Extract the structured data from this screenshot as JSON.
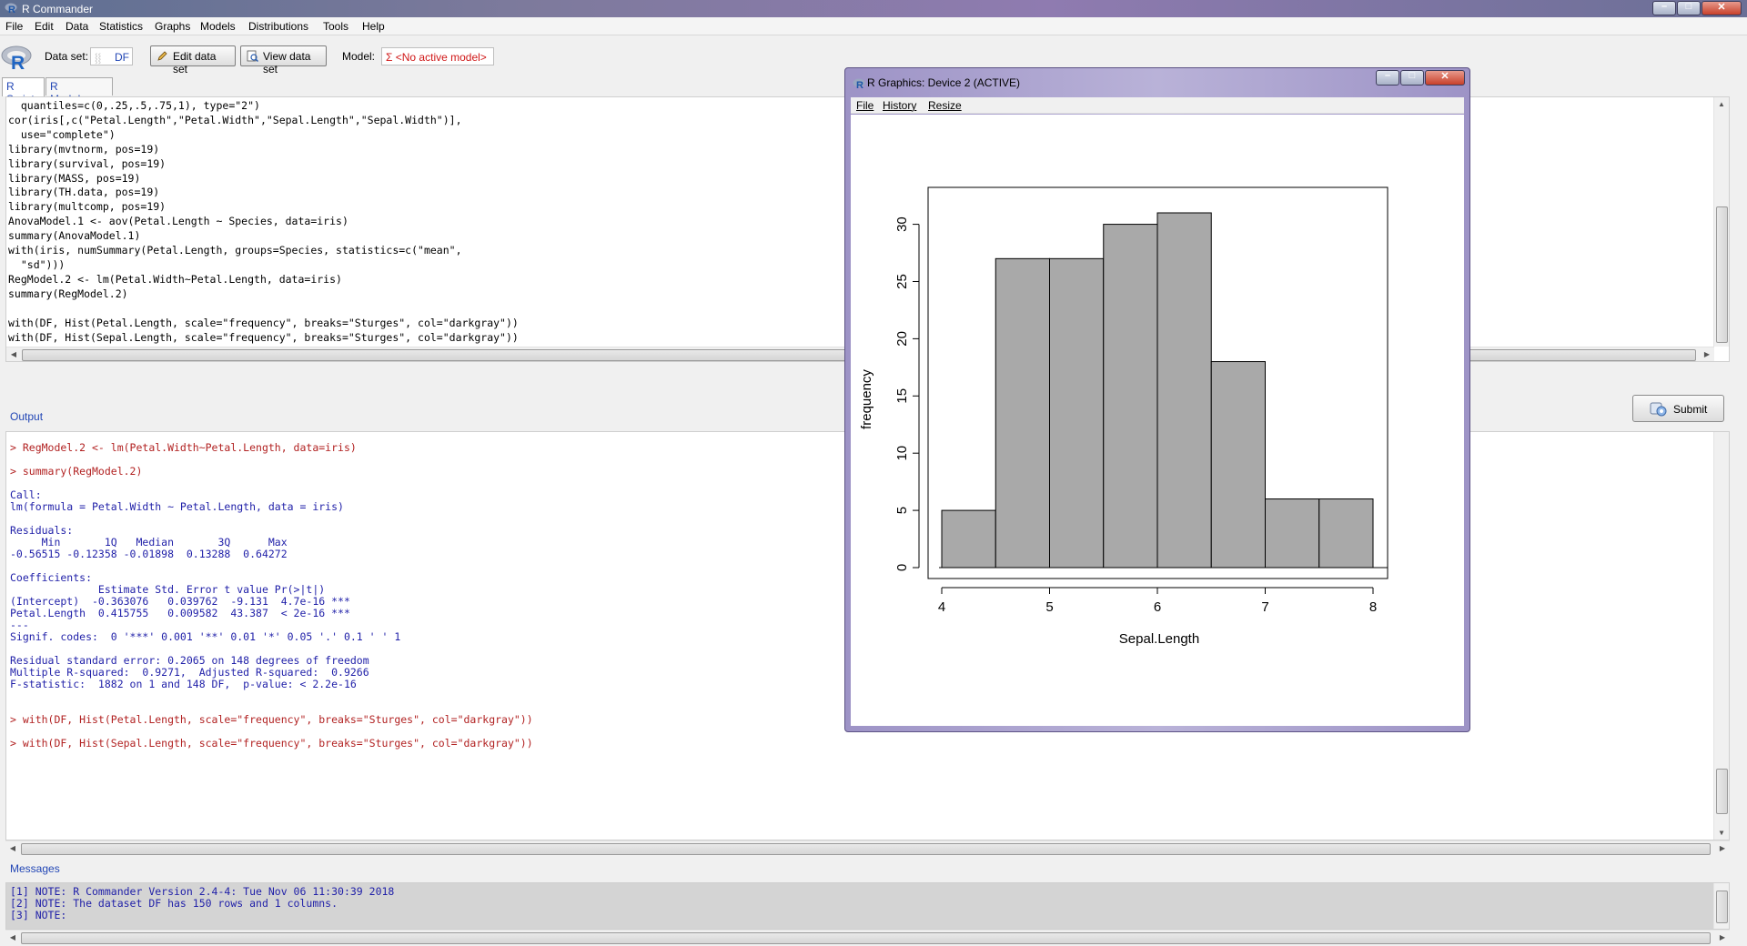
{
  "app": {
    "title": "R Commander"
  },
  "menubar": [
    "File",
    "Edit",
    "Data",
    "Statistics",
    "Graphs",
    "Models",
    "Distributions",
    "Tools",
    "Help"
  ],
  "toolbar": {
    "dataset_label": "Data set:",
    "dataset_value": "DF",
    "edit_button": "Edit data set",
    "view_button": "View data set",
    "model_label": "Model:",
    "model_value": "Σ <No active model>"
  },
  "tabs": {
    "script": "R Script",
    "markdown": "R Markdown"
  },
  "script_lines": [
    "  quantiles=c(0,.25,.5,.75,1), type=\"2\")",
    "cor(iris[,c(\"Petal.Length\",\"Petal.Width\",\"Sepal.Length\",\"Sepal.Width\")],",
    "  use=\"complete\")",
    "library(mvtnorm, pos=19)",
    "library(survival, pos=19)",
    "library(MASS, pos=19)",
    "library(TH.data, pos=19)",
    "library(multcomp, pos=19)",
    "AnovaModel.1 <- aov(Petal.Length ~ Species, data=iris)",
    "summary(AnovaModel.1)",
    "with(iris, numSummary(Petal.Length, groups=Species, statistics=c(\"mean\",",
    "  \"sd\")))",
    "RegModel.2 <- lm(Petal.Width~Petal.Length, data=iris)",
    "summary(RegModel.2)",
    "",
    "with(DF, Hist(Petal.Length, scale=\"frequency\", breaks=\"Sturges\", col=\"darkgray\"))",
    "with(DF, Hist(Sepal.Length, scale=\"frequency\", breaks=\"Sturges\", col=\"darkgray\"))"
  ],
  "labels": {
    "output": "Output",
    "messages": "Messages",
    "submit": "Submit"
  },
  "output_lines": [
    {
      "text": "> RegModel.2 <- lm(Petal.Width~Petal.Length, data=iris)",
      "kind": "cmd"
    },
    {
      "text": "> summary(RegModel.2)",
      "kind": "cmd"
    },
    {
      "text": "Call:",
      "kind": "out"
    },
    {
      "text": "lm(formula = Petal.Width ~ Petal.Length, data = iris)",
      "kind": "out"
    },
    {
      "text": "Residuals:",
      "kind": "out"
    },
    {
      "text": "     Min       1Q   Median       3Q      Max ",
      "kind": "out"
    },
    {
      "text": "-0.56515 -0.12358 -0.01898  0.13288  0.64272 ",
      "kind": "out"
    },
    {
      "text": "Coefficients:",
      "kind": "out"
    },
    {
      "text": "              Estimate Std. Error t value Pr(>|t|)    ",
      "kind": "out"
    },
    {
      "text": "(Intercept)  -0.363076   0.039762  -9.131  4.7e-16 ***",
      "kind": "out"
    },
    {
      "text": "Petal.Length  0.415755   0.009582  43.387  < 2e-16 ***",
      "kind": "out"
    },
    {
      "text": "---",
      "kind": "out"
    },
    {
      "text": "Signif. codes:  0 '***' 0.001 '**' 0.01 '*' 0.05 '.' 0.1 ' ' 1",
      "kind": "out"
    },
    {
      "text": "Residual standard error: 0.2065 on 148 degrees of freedom",
      "kind": "out"
    },
    {
      "text": "Multiple R-squared:  0.9271,\tAdjusted R-squared:  0.9266 ",
      "kind": "out"
    },
    {
      "text": "F-statistic:  1882 on 1 and 148 DF,  p-value: < 2.2e-16",
      "kind": "out"
    },
    {
      "text": "> with(DF, Hist(Petal.Length, scale=\"frequency\", breaks=\"Sturges\", col=\"darkgray\"))",
      "kind": "cmd"
    },
    {
      "text": "> with(DF, Hist(Sepal.Length, scale=\"frequency\", breaks=\"Sturges\", col=\"darkgray\"))",
      "kind": "cmd"
    }
  ],
  "message_lines": [
    "[1] NOTE: R Commander Version 2.4-4: Tue Nov 06 11:30:39 2018",
    "[2] NOTE: The dataset DF has 150 rows and 1 columns.",
    "[3] NOTE:"
  ],
  "graphics_window": {
    "title": "R Graphics: Device 2 (ACTIVE)",
    "menu": [
      "File",
      "History",
      "Resize"
    ]
  },
  "chart_data": {
    "type": "bar",
    "title": "",
    "xlabel": "Sepal.Length",
    "ylabel": "frequency",
    "bins": [
      {
        "from": 4.0,
        "to": 4.5,
        "count": 5
      },
      {
        "from": 4.5,
        "to": 5.0,
        "count": 27
      },
      {
        "from": 5.0,
        "to": 5.5,
        "count": 27
      },
      {
        "from": 5.5,
        "to": 6.0,
        "count": 30
      },
      {
        "from": 6.0,
        "to": 6.5,
        "count": 31
      },
      {
        "from": 6.5,
        "to": 7.0,
        "count": 18
      },
      {
        "from": 7.0,
        "to": 7.5,
        "count": 6
      },
      {
        "from": 7.5,
        "to": 8.0,
        "count": 6
      }
    ],
    "xticks": [
      4,
      5,
      6,
      7,
      8
    ],
    "yticks": [
      0,
      5,
      10,
      15,
      20,
      25,
      30
    ],
    "xlim": [
      4,
      8
    ],
    "ylim": [
      0,
      31
    ],
    "bar_color": "#a9a9a9",
    "grid": false
  }
}
